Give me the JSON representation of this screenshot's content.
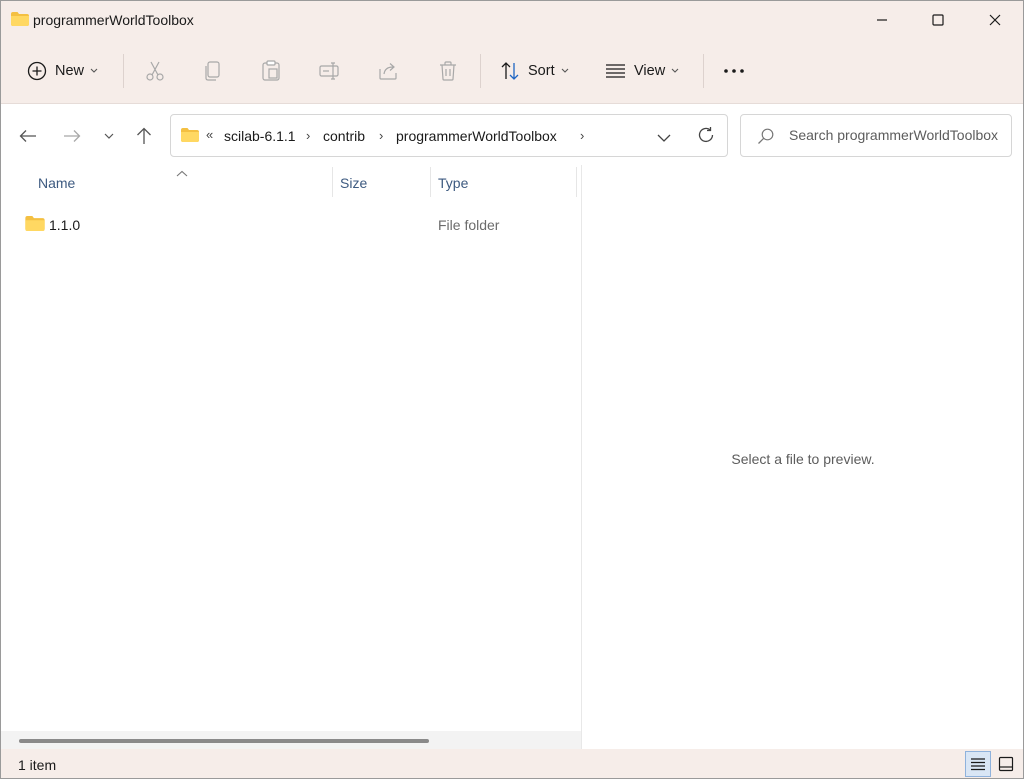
{
  "window": {
    "title": "programmerWorldToolbox"
  },
  "toolbar": {
    "new_label": "New",
    "sort_label": "Sort",
    "view_label": "View"
  },
  "address": {
    "overflow": "«",
    "segments": [
      "scilab-6.1.1",
      "contrib",
      "programmerWorldToolbox"
    ]
  },
  "search": {
    "placeholder": "Search programmerWorldToolbox"
  },
  "list": {
    "columns": [
      "Name",
      "Size",
      "Type"
    ],
    "rows": [
      {
        "name": "1.1.0",
        "size": "",
        "type": "File folder"
      }
    ]
  },
  "preview": {
    "message": "Select a file to preview."
  },
  "status": {
    "item_count": "1 item"
  },
  "colors": {
    "chrome": "#f6ede9",
    "folder": "#f4c042",
    "accent": "#3d5a80"
  },
  "icons": {
    "title": "folder-icon",
    "toolbar": [
      "new-icon",
      "cut-icon",
      "copy-icon",
      "paste-icon",
      "rename-icon",
      "share-icon",
      "delete-icon",
      "sort-icon",
      "view-icon",
      "more-icon"
    ],
    "nav": [
      "back-arrow-icon",
      "forward-arrow-icon",
      "recent-chevron-icon",
      "up-arrow-icon"
    ]
  }
}
